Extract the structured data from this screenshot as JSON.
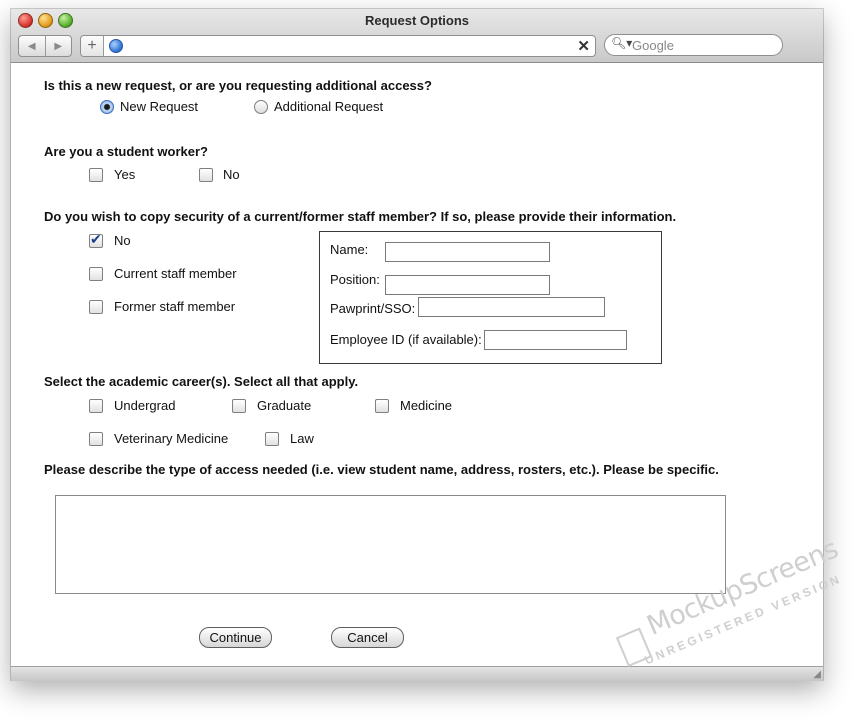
{
  "window": {
    "title": "Request Options"
  },
  "browser": {
    "url": "",
    "search_placeholder": "Google"
  },
  "form": {
    "q1": {
      "question": "Is this a new request, or are you requesting additional access?",
      "options": [
        "New Request",
        "Additional Request"
      ],
      "selected": "New Request"
    },
    "q2": {
      "question": "Are you a student worker?",
      "options": [
        "Yes",
        "No"
      ]
    },
    "q3": {
      "question": "Do you wish to copy security of a current/former staff member? If so, please provide their information.",
      "options": [
        "No",
        "Current staff member",
        "Former staff member"
      ],
      "checked": "No",
      "fields": {
        "name_label": "Name:",
        "position_label": "Position:",
        "pawprint_label": "Pawprint/SSO:",
        "employee_id_label": "Employee ID (if available):"
      }
    },
    "q4": {
      "question": "Select the academic career(s). Select all that apply.",
      "options": [
        "Undergrad",
        "Graduate",
        "Medicine",
        "Veterinary Medicine",
        "Law"
      ]
    },
    "q5": {
      "question": "Please describe the type of access needed (i.e. view student name, address, rosters, etc.). Please be specific."
    },
    "buttons": {
      "continue": "Continue",
      "cancel": "Cancel"
    }
  },
  "watermark": {
    "brand": "MockupScreens",
    "sub": "UNREGISTERED VERSION"
  }
}
